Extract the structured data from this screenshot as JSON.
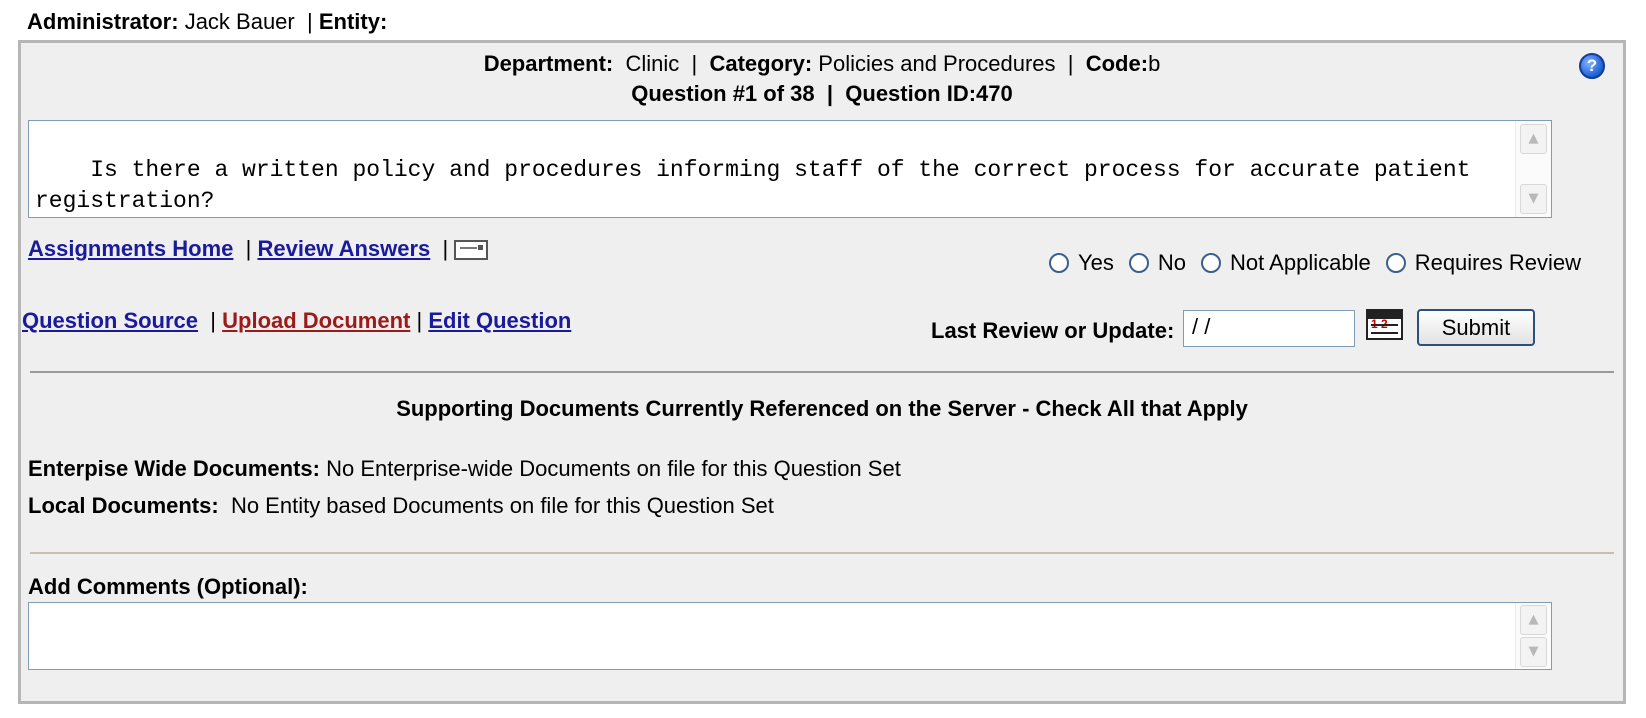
{
  "header": {
    "administrator_label": "Administrator:",
    "administrator_name": "Jack Bauer",
    "separator": "|",
    "entity_label": "Entity:"
  },
  "question_info": {
    "department_label": "Department:",
    "department_value": "Clinic",
    "category_label": "Category:",
    "category_value": "Policies and Procedures",
    "code_label": "Code:",
    "code_value": "b",
    "question_number_text": "Question #1 of 38",
    "question_id_text": "Question ID:470",
    "separator": "|",
    "help_glyph": "?"
  },
  "question_text": "Is there a written policy and procedures informing staff of the correct process for accurate patient registration?",
  "nav_links": {
    "assignments_home": "Assignments Home",
    "review_answers": "Review Answers",
    "question_source": "Question Source",
    "upload_document": "Upload Document",
    "edit_question": "Edit Question",
    "separator": "|",
    "email_icon": "envelope-icon"
  },
  "answer_options": [
    "Yes",
    "No",
    "Not Applicable",
    "Requires Review"
  ],
  "review": {
    "label": "Last Review or Update:",
    "date_value": " /  /",
    "calendar_icon": "calendar-icon",
    "submit_label": "Submit"
  },
  "documents": {
    "heading": "Supporting Documents Currently Referenced on the Server - Check All that Apply",
    "enterprise_label": "Enterpise Wide Documents:",
    "enterprise_value": "No Enterprise-wide Documents on file for this Question Set",
    "local_label": "Local Documents:",
    "local_value": "No Entity based Documents on file for this Question Set"
  },
  "comments": {
    "label": "Add Comments (Optional):",
    "value": ""
  },
  "scroll_icons": {
    "up": "▲",
    "down": "▼"
  },
  "colors": {
    "panel_bg": "#efefef",
    "panel_border": "#b6b6b6",
    "link": "#1a1a9c",
    "link_red": "#9c1a1a"
  }
}
